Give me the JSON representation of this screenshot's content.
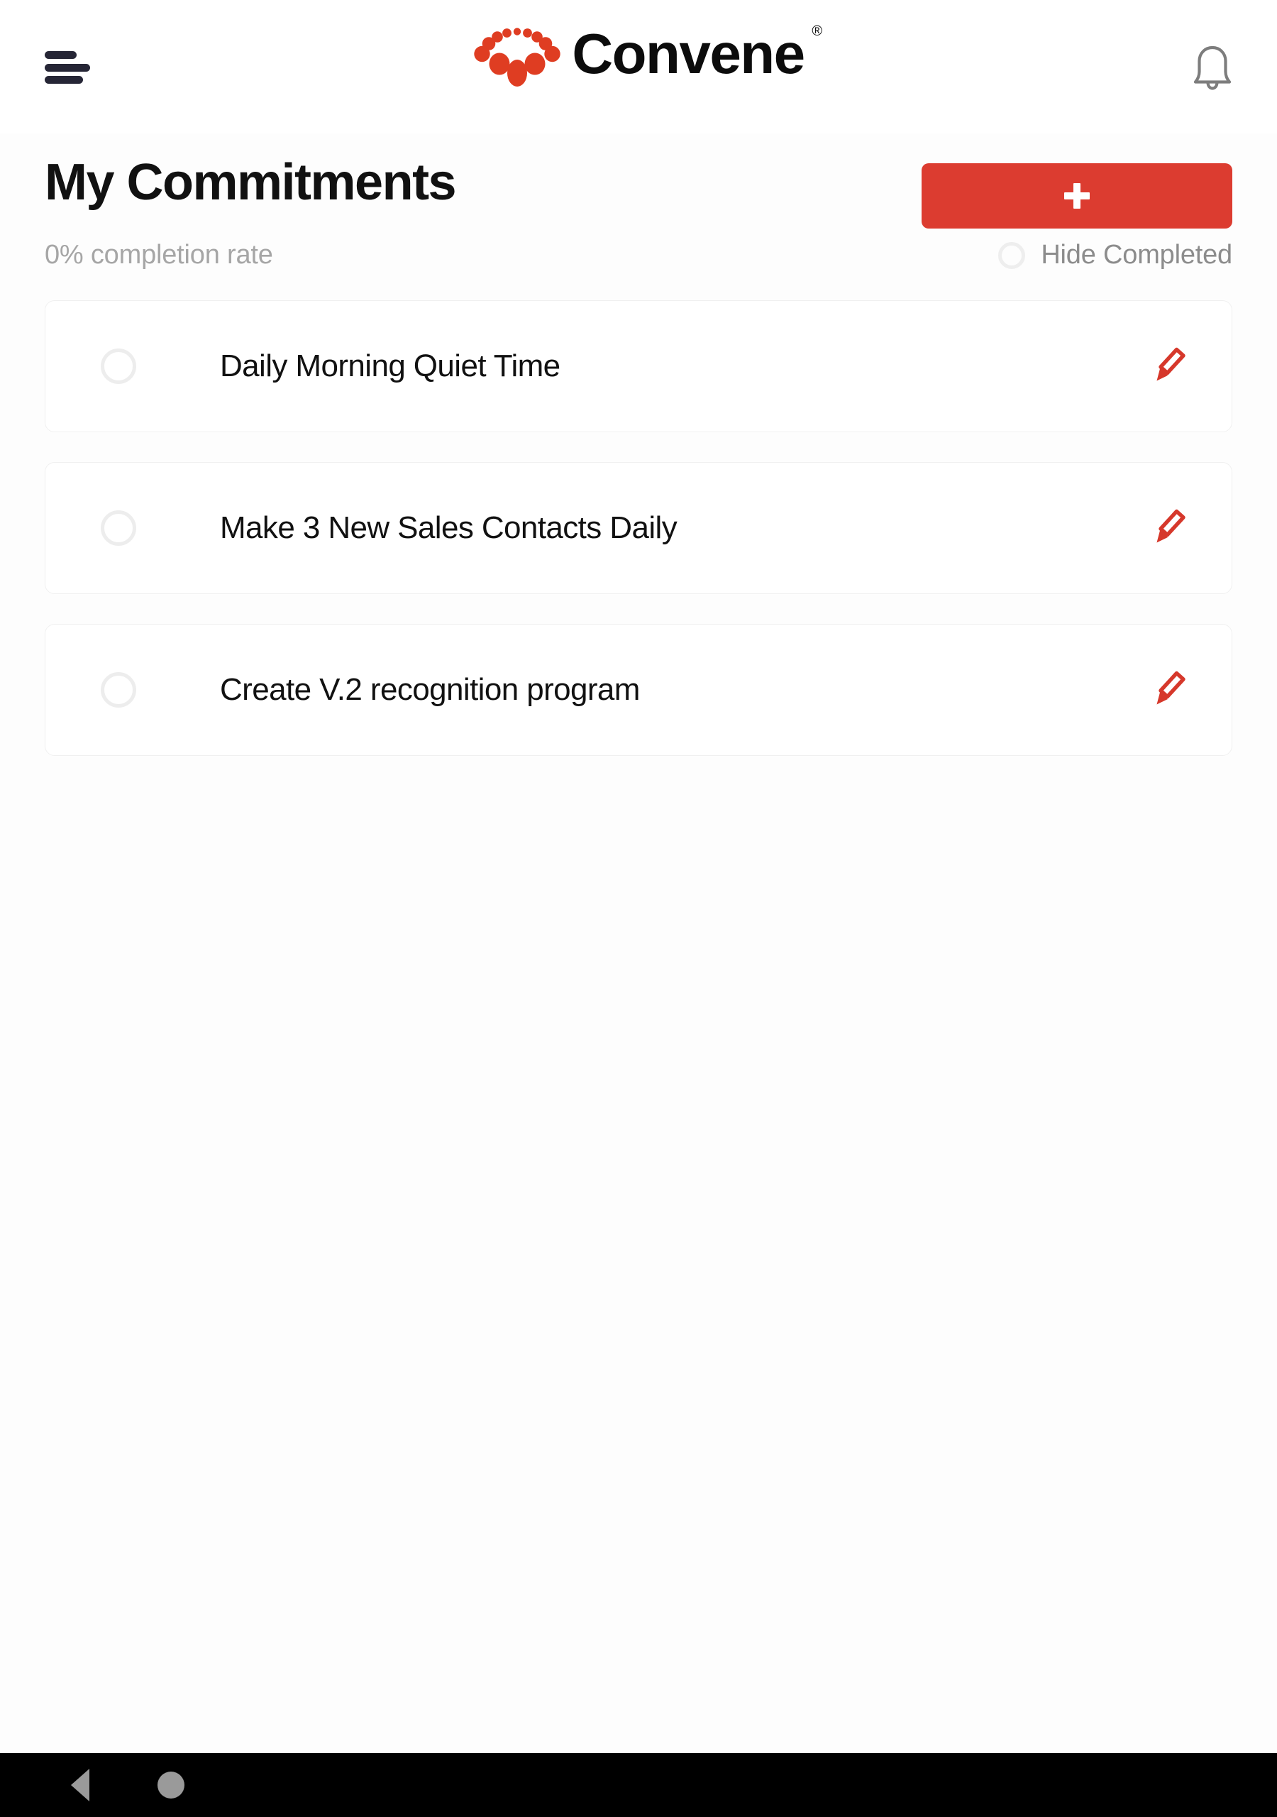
{
  "appbar": {
    "menu_icon": "hamburger-menu-icon",
    "brand_name": "Convene",
    "brand_trademark": "®",
    "brand_logo_icon": "convene-dot-arc-logo",
    "notifications_icon": "bell-icon"
  },
  "header": {
    "title": "My Commitments",
    "add_button_icon": "plus-icon",
    "add_button_label": ""
  },
  "subheader": {
    "completion_rate": "0% completion rate",
    "hide_completed_label": "Hide Completed",
    "hide_completed_checked": false
  },
  "commitments": [
    {
      "label": "Daily Morning Quiet Time",
      "completed": false,
      "edit_icon": "pencil-edit-icon"
    },
    {
      "label": "Make 3 New Sales Contacts Daily",
      "completed": false,
      "edit_icon": "pencil-edit-icon"
    },
    {
      "label": "Create V.2 recognition program",
      "completed": false,
      "edit_icon": "pencil-edit-icon"
    }
  ],
  "navbar": {
    "back_icon": "back-triangle-icon",
    "home_icon": "home-circle-icon"
  },
  "colors": {
    "brand_red": "#DC3C30",
    "logo_red": "#DF3D22",
    "text_primary": "#111111",
    "text_muted": "#a6a6a6",
    "page_background": "#fdfdfd",
    "navbar_background": "#000000"
  }
}
